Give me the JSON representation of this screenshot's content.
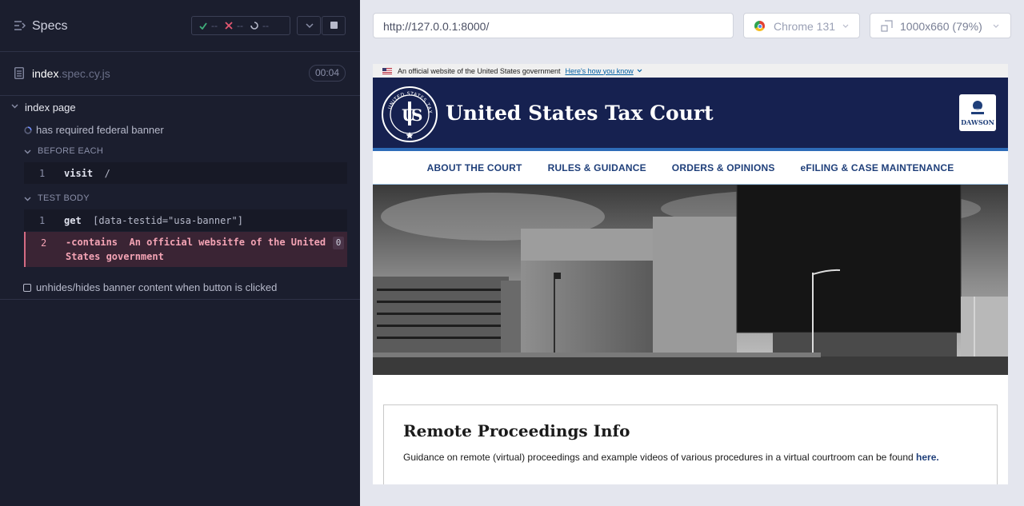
{
  "reporter": {
    "title": "Specs",
    "stats": {
      "passed": "--",
      "failed": "--",
      "pending": "--"
    },
    "file_name": "index",
    "file_ext": ".spec.cy.js",
    "duration": "00:04",
    "suite_title": "index page",
    "tests": [
      {
        "title": "has required federal banner"
      },
      {
        "title": "unhides/hides banner content when button is clicked"
      }
    ],
    "before_each_label": "BEFORE EACH",
    "test_body_label": "TEST BODY",
    "commands": {
      "visit": {
        "num": "1",
        "name": "visit",
        "arg": "/"
      },
      "get": {
        "num": "1",
        "name": "get",
        "arg": "[data-testid=\"usa-banner\"]"
      },
      "contains": {
        "num": "2",
        "name": "-contains",
        "arg_line1": "An official websitfe of the United",
        "arg_line2": "States government",
        "badge": "0"
      }
    }
  },
  "browser_bar": {
    "url": "http://127.0.0.1:8000/",
    "browser": "Chrome 131",
    "viewport": "1000x660",
    "zoom": "(79%)"
  },
  "site": {
    "gov_banner": "An official website of the United States government",
    "gov_link": "Here's how you know",
    "title": "United States Tax Court",
    "seal_text": "UNITED STATES TAX COURT",
    "badge": "DAWSON",
    "nav": [
      "ABOUT THE COURT",
      "RULES & GUIDANCE",
      "ORDERS & OPINIONS",
      "eFILING & CASE MAINTENANCE"
    ],
    "card_title": "Remote Proceedings Info",
    "card_text": "Guidance on remote (virtual) proceedings and example videos of various procedures in a virtual courtroom can be found",
    "card_link": "here."
  },
  "colors": {
    "reporter_bg": "#1b1e2e",
    "masthead": "#162150",
    "nav_text": "#1f3f7a",
    "fail": "#d56c84"
  }
}
